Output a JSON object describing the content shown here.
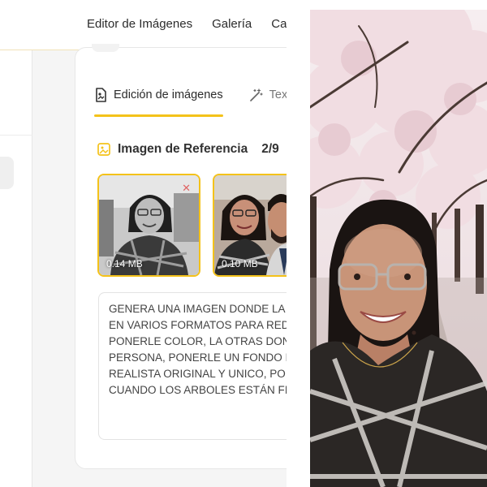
{
  "nav": {
    "items": [
      "Editor de Imágenes",
      "Galería",
      "Caj"
    ]
  },
  "tabs": [
    {
      "label": "Edición de imágenes",
      "icon": "image-edit-icon",
      "active": true
    },
    {
      "label": "Texto",
      "icon": "magic-wand-icon",
      "active": false
    }
  ],
  "reference": {
    "title": "Imagen de Referencia",
    "count": "2/9",
    "icon": "image-stack-icon"
  },
  "thumbnails": [
    {
      "size": "0.14 MB",
      "style": "grayscale"
    },
    {
      "size": "0.10 MB",
      "style": "color"
    }
  ],
  "prompt": {
    "lines": [
      "GENERA UNA IMAGEN DONDE LA",
      "EN VARIOS FORMATOS PARA RED",
      "PONERLE  COLOR, LA OTRAS DON",
      "PERSONA, PONERLE UN FONDO I",
      "REALISTA ORIGINAL Y UNICO, POI",
      "CUANDO LOS ARBOLES ESTÁN FI"
    ]
  },
  "colors": {
    "accent": "#f4c21a",
    "blossom": "#f1dde2",
    "trunk": "#4a3a34"
  }
}
